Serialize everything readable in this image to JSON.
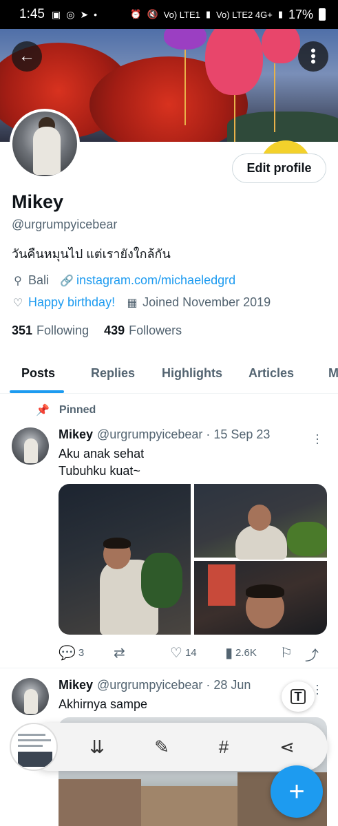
{
  "status_bar": {
    "time": "1:45",
    "network1": "Vo) LTE1",
    "network2": "Vo) LTE2 4G+",
    "battery": "17%"
  },
  "header": {
    "back_icon": "arrow-left-icon",
    "more_icon": "more-vertical-icon"
  },
  "profile": {
    "edit_label": "Edit profile",
    "name": "Mikey",
    "handle": "@urgrumpyicebear",
    "bio": "วันคืนหมุนไป แต่เรายังใกล้กัน",
    "location": "Bali",
    "website": "instagram.com/michaeledgrd",
    "birthday": "Happy birthday!",
    "joined": "Joined November 2019",
    "following_count": "351",
    "following_label": "Following",
    "followers_count": "439",
    "followers_label": "Followers"
  },
  "tabs": [
    {
      "label": "Posts"
    },
    {
      "label": "Replies"
    },
    {
      "label": "Highlights"
    },
    {
      "label": "Articles"
    },
    {
      "label": "M"
    }
  ],
  "pinned_label": "Pinned",
  "tweets": [
    {
      "name": "Mikey",
      "meta": "@urgrumpyicebear · 15 Sep 23",
      "line1": "Aku anak sehat",
      "line2": "Tubuhku kuat~",
      "replies": "3",
      "likes": "14",
      "views": "2.6K"
    },
    {
      "name": "Mikey",
      "meta": "@urgrumpyicebear · 28 Jun",
      "line1": "Akhirnya sampe"
    }
  ],
  "colors": {
    "accent": "#1d9bf0",
    "text": "#0f1419",
    "secondary": "#536471"
  }
}
